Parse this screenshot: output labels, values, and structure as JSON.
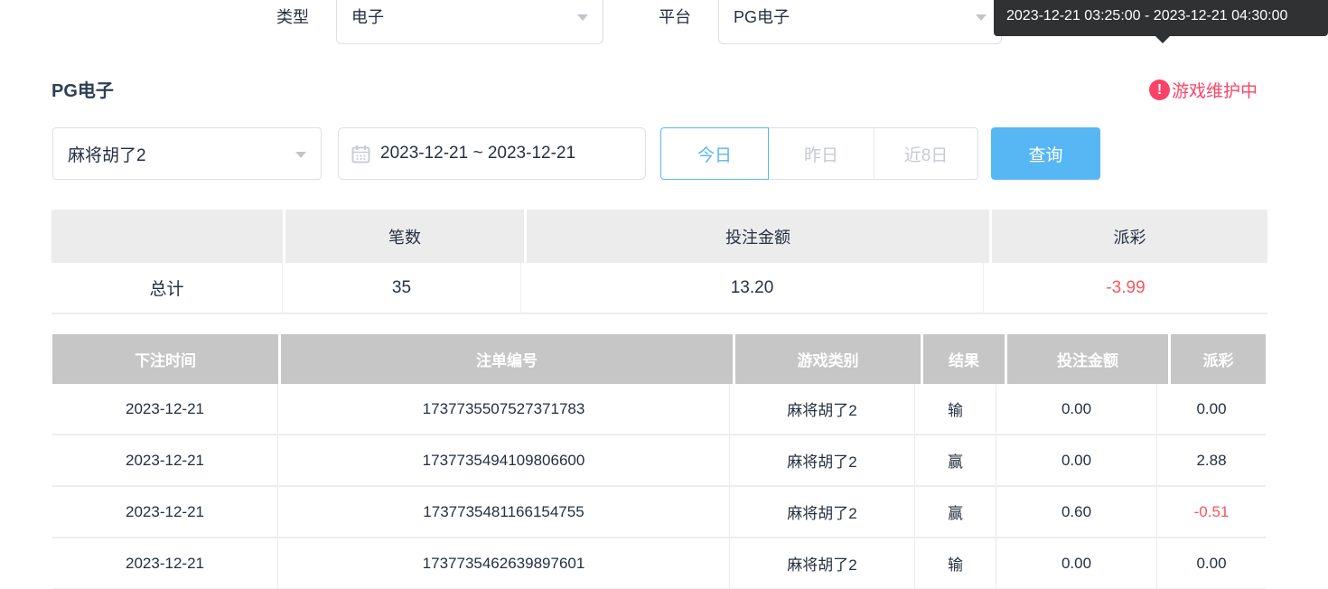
{
  "filters_top": {
    "type_label": "类型",
    "type_value": "电子",
    "platform_label": "平台",
    "platform_value": "PG电子"
  },
  "tooltip": {
    "text": "2023-12-21 03:25:00 - 2023-12-21 04:30:00"
  },
  "section": {
    "title": "PG电子",
    "maintenance_badge": "游戏维护中",
    "maintenance_icon": "!"
  },
  "filters": {
    "game_value": "麻将胡了2",
    "date_range": "2023-12-21 ~ 2023-12-21",
    "quick_buttons": [
      "今日",
      "昨日",
      "近8日"
    ],
    "active_quick_button": "今日",
    "search_label": "查询"
  },
  "summary_table": {
    "headers": [
      "",
      "笔数",
      "投注金额",
      "派彩"
    ],
    "row": {
      "label": "总计",
      "count": "35",
      "bet_amount": "13.20",
      "payout": "-3.99"
    }
  },
  "detail_table": {
    "headers": [
      "下注时间",
      "注单编号",
      "游戏类别",
      "结果",
      "投注金额",
      "派彩"
    ],
    "rows": [
      {
        "time": "2023-12-21",
        "order_no": "1737735507527371783",
        "game": "麻将胡了2",
        "result": "输",
        "bet": "0.00",
        "payout": "0.00"
      },
      {
        "time": "2023-12-21",
        "order_no": "1737735494109806600",
        "game": "麻将胡了2",
        "result": "赢",
        "bet": "0.00",
        "payout": "2.88"
      },
      {
        "time": "2023-12-21",
        "order_no": "1737735481166154755",
        "game": "麻将胡了2",
        "result": "赢",
        "bet": "0.60",
        "payout": "-0.51"
      },
      {
        "time": "2023-12-21",
        "order_no": "1737735462639897601",
        "game": "麻将胡了2",
        "result": "输",
        "bet": "0.00",
        "payout": "0.00"
      }
    ]
  },
  "colors": {
    "accent_blue": "#57b6f4",
    "negative_red": "#f8565f",
    "maintenance_pink": "#fb4368",
    "table_header_gray": "#c6c6c6",
    "summary_header_gray": "#ececec",
    "tooltip_bg": "#2f3133",
    "border_gray": "#dcdfe6"
  }
}
